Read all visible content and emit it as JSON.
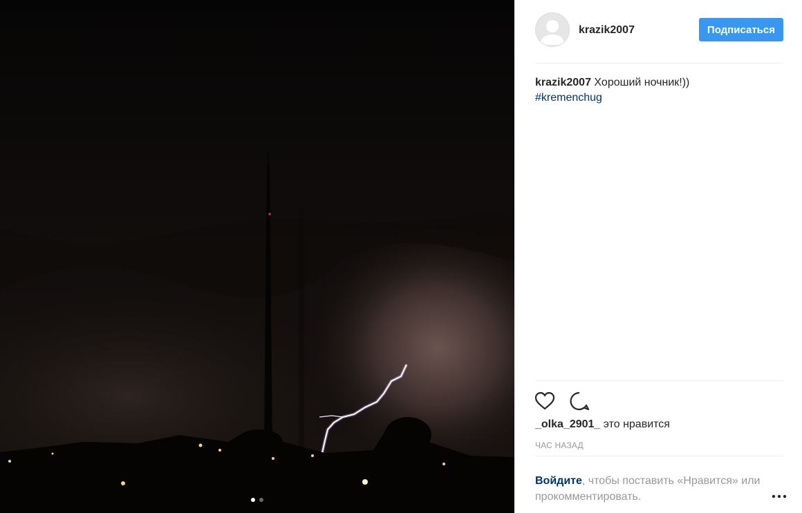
{
  "post": {
    "username": "krazik2007",
    "follow_label": "Подписаться",
    "caption_text": "Хороший ночник!))",
    "hashtag": "#kremenchug",
    "likes_user": "_olka_2901_",
    "likes_suffix": "это нравится",
    "timestamp": "час назад",
    "login_link": "Войдите",
    "login_rest": ", чтобы поставить «Нравится» или прокомментировать.",
    "carousel": {
      "total": 2,
      "active": 1
    }
  },
  "icons": {
    "avatar": "default-avatar-icon",
    "like": "heart-icon",
    "comment": "comment-bubble-icon",
    "more": "more-dots-icon"
  },
  "colors": {
    "accent": "#3897f0",
    "link": "#003569",
    "muted": "#999999",
    "divider": "#efefef"
  }
}
